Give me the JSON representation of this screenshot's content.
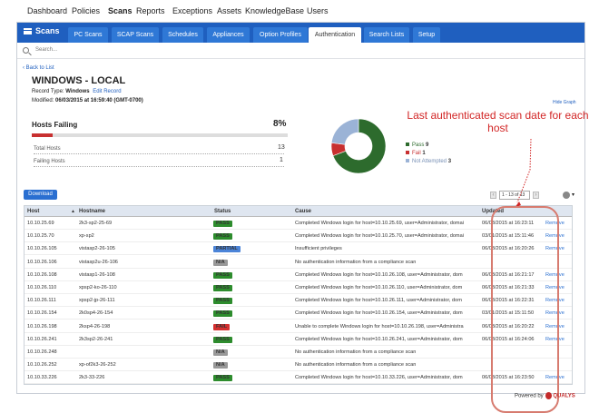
{
  "topnav": [
    "Dashboard",
    "Policies",
    "Scans",
    "Reports",
    "Exceptions",
    "Assets",
    "KnowledgeBase",
    "Users"
  ],
  "app": {
    "brand": "Scans",
    "tabs": [
      "PC Scans",
      "SCAP Scans",
      "Schedules",
      "Appliances",
      "Option Profiles",
      "Authentication",
      "Search Lists",
      "Setup"
    ]
  },
  "search": {
    "placeholder": "Search..."
  },
  "back": "Back to List",
  "detail": {
    "title": "WINDOWS - LOCAL",
    "record_type_label": "Record Type:",
    "record_type": "Windows",
    "edit_record": "Edit Record",
    "modified_label": "Modified:",
    "modified_value": "06/03/2015 at 16:59:40 (GMT-0700)"
  },
  "hosts_failing": {
    "title": "Hosts Failing",
    "percent": "8%",
    "fraction": 0.08,
    "total_label": "Total Hosts",
    "total_value": "13",
    "failing_label": "Failing Hosts",
    "failing_value": "1"
  },
  "chart_data": {
    "type": "pie",
    "categories": [
      "Pass",
      "Fail",
      "Not Attempted"
    ],
    "values": [
      9,
      1,
      3
    ],
    "colors": [
      "#2d6b2d",
      "#c83030",
      "#9bb3d6"
    ]
  },
  "hide_graph": "Hide Graph",
  "callout": "Last authenticated scan date for each host",
  "download_label": "Download",
  "pager": {
    "label": "1 - 13 of 13"
  },
  "table": {
    "headers": [
      "Host",
      "Hostname",
      "Status",
      "Cause",
      "Updated"
    ],
    "rows": [
      {
        "host": "10.10.25.69",
        "hostname": "2k3-sp2-25-69",
        "status": "PASS",
        "cause": "Completed Windows login for host=10.10.25.69, user=Administrator, domai",
        "updated": "06/03/2015 at 16:23:11",
        "action": "Remove"
      },
      {
        "host": "10.10.25.70",
        "hostname": "xp-sp2",
        "status": "PASS",
        "cause": "Completed Windows login for host=10.10.25.70, user=Administrator, domai",
        "updated": "03/01/2015 at 15:11:46",
        "action": "Remove"
      },
      {
        "host": "10.10.26.105",
        "hostname": "vistasp2-26-105",
        "status": "PARTIAL",
        "cause": "Insufficient privileges",
        "updated": "06/03/2015 at 16:20:26",
        "action": "Remove"
      },
      {
        "host": "10.10.26.106",
        "hostname": "vistasp2u-26-106",
        "status": "N/A",
        "cause": "No authentication information from a compliance scan",
        "updated": "",
        "action": ""
      },
      {
        "host": "10.10.26.108",
        "hostname": "vistasp1-26-108",
        "status": "PASS",
        "cause": "Completed Windows login for host=10.10.26.108, user=Administrator, dom",
        "updated": "06/03/2015 at 16:21:17",
        "action": "Remove"
      },
      {
        "host": "10.10.26.110",
        "hostname": "xpsp2-ko-26-110",
        "status": "PASS",
        "cause": "Completed Windows login for host=10.10.26.110, user=Administrator, dom",
        "updated": "06/03/2015 at 16:21:33",
        "action": "Remove"
      },
      {
        "host": "10.10.26.111",
        "hostname": "xpsp2-jp-26-111",
        "status": "PASS",
        "cause": "Completed Windows login for host=10.10.26.111, user=Administrator, dom",
        "updated": "06/03/2015 at 16:22:31",
        "action": "Remove"
      },
      {
        "host": "10.10.26.154",
        "hostname": "2k0sp4-26-154",
        "status": "PASS",
        "cause": "Completed Windows login for host=10.10.26.154, user=Administrator, dom",
        "updated": "03/01/2015 at 15:11:50",
        "action": "Remove"
      },
      {
        "host": "10.10.26.198",
        "hostname": "2ksp4-26-198",
        "status": "FAIL",
        "cause": "Unable to complete Windows login for host=10.10.26.198, user=Administra",
        "updated": "06/03/2015 at 16:20:22",
        "action": "Remove"
      },
      {
        "host": "10.10.26.241",
        "hostname": "2k3sp2-26-241",
        "status": "PASS",
        "cause": "Completed Windows login for host=10.10.26.241, user=Administrator, dom",
        "updated": "06/03/2015 at 16:24:06",
        "action": "Remove"
      },
      {
        "host": "10.10.26.248",
        "hostname": "",
        "status": "N/A",
        "cause": "No authentication information from a compliance scan",
        "updated": "",
        "action": ""
      },
      {
        "host": "10.10.26.252",
        "hostname": "xp-of2k3-26-252",
        "status": "N/A",
        "cause": "No authentication information from a compliance scan",
        "updated": "",
        "action": ""
      },
      {
        "host": "10.10.33.226",
        "hostname": "2k3-33-226",
        "status": "PASS",
        "cause": "Completed Windows login for host=10.10.33.226, user=Administrator, dom",
        "updated": "06/03/2015 at 16:23:50",
        "action": "Remove"
      }
    ]
  },
  "footer": "Powered by"
}
